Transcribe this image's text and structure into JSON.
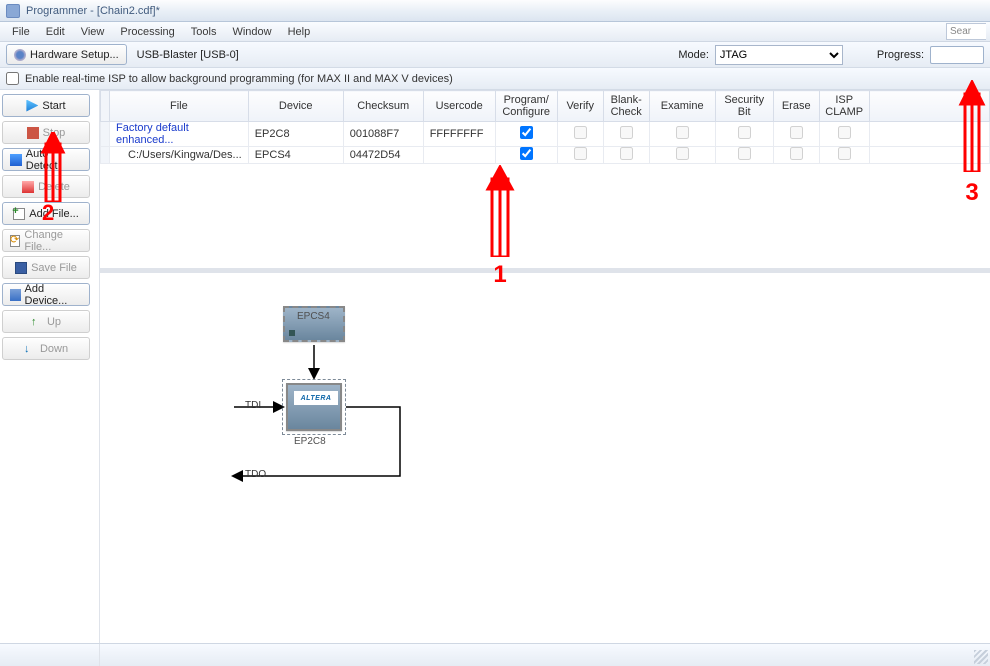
{
  "window": {
    "title": "Programmer - [Chain2.cdf]*"
  },
  "menu": {
    "file": "File",
    "edit": "Edit",
    "view": "View",
    "processing": "Processing",
    "tools": "Tools",
    "window": "Window",
    "help": "Help"
  },
  "search_placeholder": "Sear",
  "toolbar": {
    "hardware_setup": "Hardware Setup...",
    "hardware_status": "USB-Blaster [USB-0]",
    "mode_label": "Mode:",
    "mode_value": "JTAG",
    "progress_label": "Progress:"
  },
  "option": {
    "checked": false,
    "label": "Enable real-time ISP to allow background programming (for MAX II and MAX V devices)"
  },
  "sidebar": {
    "start": "Start",
    "stop": "Stop",
    "auto_detect": "Auto Detect",
    "delete": "Delete",
    "add_file": "Add File...",
    "change_file": "Change File...",
    "save_file": "Save File",
    "add_device": "Add Device...",
    "up": "Up",
    "down": "Down"
  },
  "grid": {
    "cols": {
      "file": "File",
      "device": "Device",
      "checksum": "Checksum",
      "usercode": "Usercode",
      "program": "Program/ Configure",
      "verify": "Verify",
      "blank": "Blank- Check",
      "examine": "Examine",
      "security": "Security Bit",
      "erase": "Erase",
      "isp": "ISP CLAMP"
    },
    "rows": [
      {
        "file": "Factory default enhanced...",
        "device": "EP2C8",
        "checksum": "001088F7",
        "usercode": "FFFFFFFF",
        "program": true,
        "link": true
      },
      {
        "file": "C:/Users/Kingwa/Des...",
        "device": "EPCS4",
        "checksum": "04472D54",
        "usercode": "",
        "program": true,
        "link": false
      }
    ]
  },
  "diagram": {
    "epcs_label": "EPCS4",
    "ep2c8_label": "EP2C8",
    "altera": "ALTERA",
    "tdi": "TDI",
    "tdo": "TDO"
  },
  "annotations": {
    "a1": "1",
    "a2": "2",
    "a3": "3"
  }
}
